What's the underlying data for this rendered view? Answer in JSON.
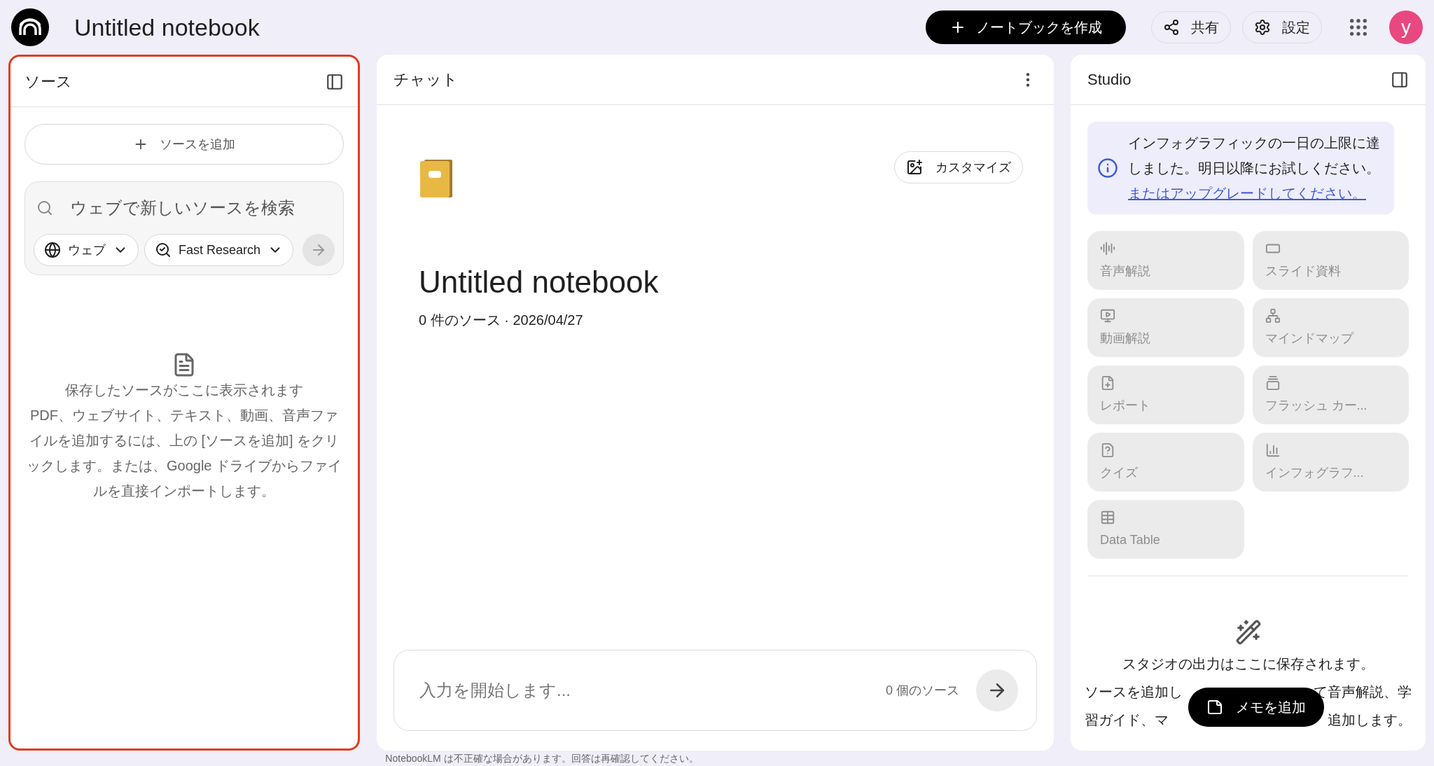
{
  "header": {
    "title": "Untitled notebook",
    "create_button": "ノートブックを作成",
    "share_button": "共有",
    "settings_button": "設定",
    "avatar": "y"
  },
  "sources": {
    "title": "ソース",
    "add_button": "ソースを追加",
    "search": {
      "placeholder": "ウェブで新しいソースを検索"
    },
    "source_type": "ウェブ",
    "research_mode": "Fast Research",
    "empty": {
      "title": "保存したソースがここに表示されます",
      "body": "PDF、ウェブサイト、テキスト、動画、音声ファイルを追加するには、上の [ソースを追加] をクリックします。または、Google ドライブからファイルを直接インポートします。"
    }
  },
  "chat": {
    "title": "チャット",
    "customize_button": "カスタマイズ",
    "notebook_title": "Untitled notebook",
    "notebook_meta": "0 件のソース · 2026/04/27",
    "input": {
      "placeholder": "入力を開始します..."
    },
    "source_count": "0 個のソース"
  },
  "studio": {
    "title": "Studio",
    "notice": "インフォグラフィックの一日の上限に達しました。明日以降にお試しください。",
    "notice_link": "またはアップグレードしてください。",
    "tiles": [
      {
        "kind": "audio",
        "label": "音声解説",
        "disabled": true
      },
      {
        "kind": "slides",
        "label": "スライド資料",
        "disabled": true
      },
      {
        "kind": "video",
        "label": "動画解説",
        "disabled": true
      },
      {
        "kind": "mindmap",
        "label": "マインドマップ",
        "disabled": true
      },
      {
        "kind": "report",
        "label": "レポート",
        "disabled": true
      },
      {
        "kind": "flashcards",
        "label": "フラッシュ カー...",
        "disabled": true
      },
      {
        "kind": "quiz",
        "label": "クイズ",
        "disabled": true
      },
      {
        "kind": "infographic",
        "label": "インフォグラフ...",
        "disabled": true
      },
      {
        "kind": "table",
        "label": "Data Table",
        "disabled": true
      }
    ],
    "empty_title": "スタジオの出力はここに保存されます。",
    "empty_fragments": [
      [
        "ソースを追加し",
        "て音声解説、学"
      ],
      [
        "習ガイド、マ",
        "追加します。"
      ]
    ],
    "memo_button": "メモを追加"
  },
  "footer": "NotebookLM は不正確な場合があります。回答は再確認してください。"
}
